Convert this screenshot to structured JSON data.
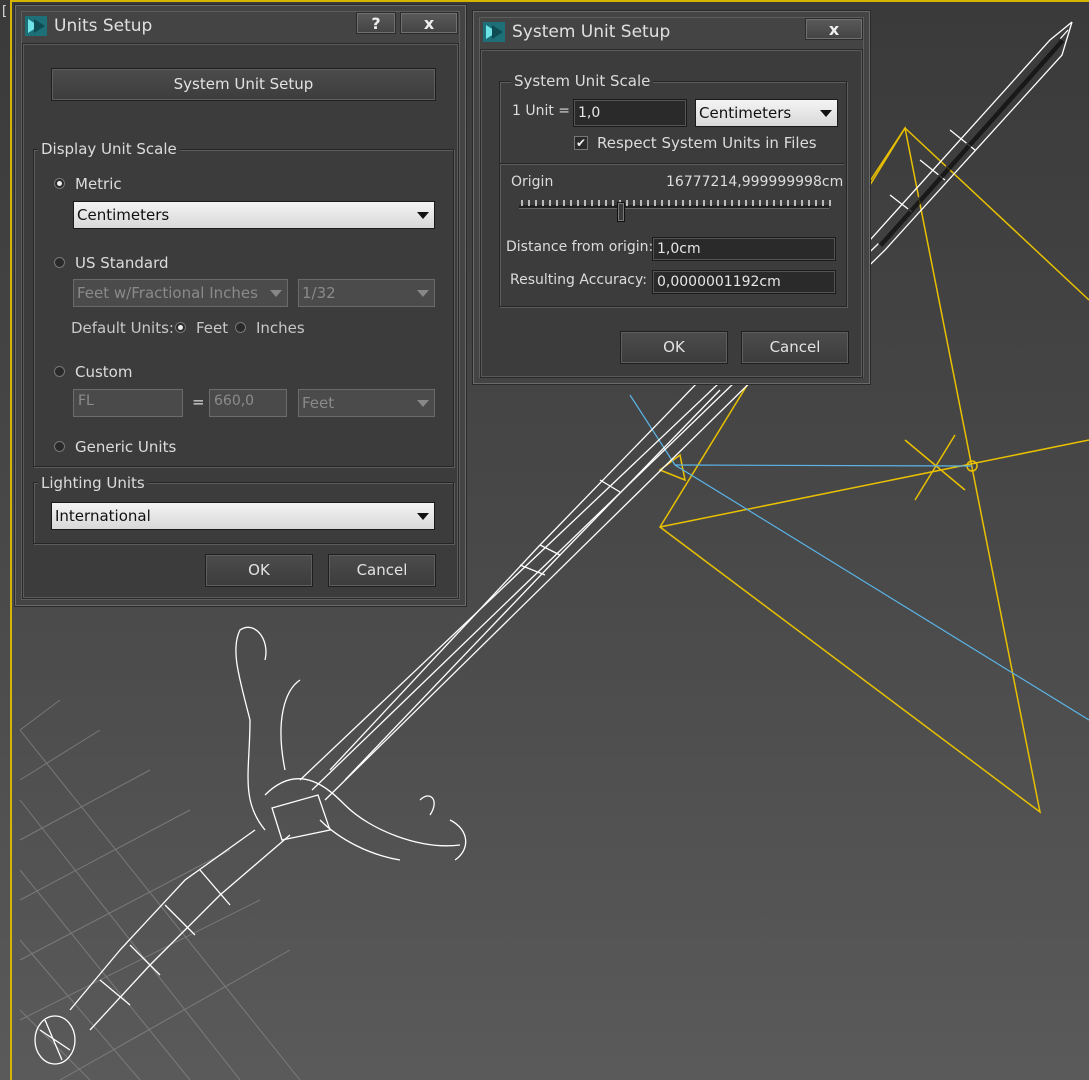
{
  "viewport": {
    "label": "["
  },
  "units_setup": {
    "title": "Units Setup",
    "help_label": "?",
    "close_label": "x",
    "system_unit_setup_button": "System Unit Setup",
    "display_unit_scale": {
      "group_label": "Display Unit Scale",
      "metric_label": "Metric",
      "metric_value": "Centimeters",
      "us_standard_label": "US Standard",
      "us_unit_value": "Feet w/Fractional Inches",
      "us_fraction_value": "1/32",
      "default_units_label": "Default Units:",
      "feet_label": "Feet",
      "inches_label": "Inches",
      "custom_label": "Custom",
      "custom_name_value": "FL",
      "equals_label": "=",
      "custom_amount_value": "660,0",
      "custom_unit_value": "Feet",
      "generic_units_label": "Generic Units"
    },
    "lighting_units": {
      "group_label": "Lighting Units",
      "value": "International"
    },
    "ok_label": "OK",
    "cancel_label": "Cancel"
  },
  "system_unit_setup": {
    "title": "System Unit Setup",
    "close_label": "x",
    "group_label": "System Unit Scale",
    "one_unit_label": "1 Unit =",
    "one_unit_value": "1,0",
    "unit_type_value": "Centimeters",
    "respect_label": "Respect System Units in Files",
    "origin_label": "Origin",
    "origin_value": "16777214,999999998cm",
    "distance_label": "Distance from origin:",
    "distance_value": "1,0cm",
    "accuracy_label": "Resulting Accuracy:",
    "accuracy_value": "0,0000001192cm",
    "ok_label": "OK",
    "cancel_label": "Cancel"
  },
  "colors": {
    "viewport_border": "#d6b400",
    "wireframe": "#ffffff",
    "camera": "#e8c000",
    "target_line": "#5ab4e8"
  },
  "icons": [
    "3dsmax-app-icon",
    "help-icon",
    "close-icon",
    "dropdown-arrow-icon",
    "check-icon"
  ]
}
